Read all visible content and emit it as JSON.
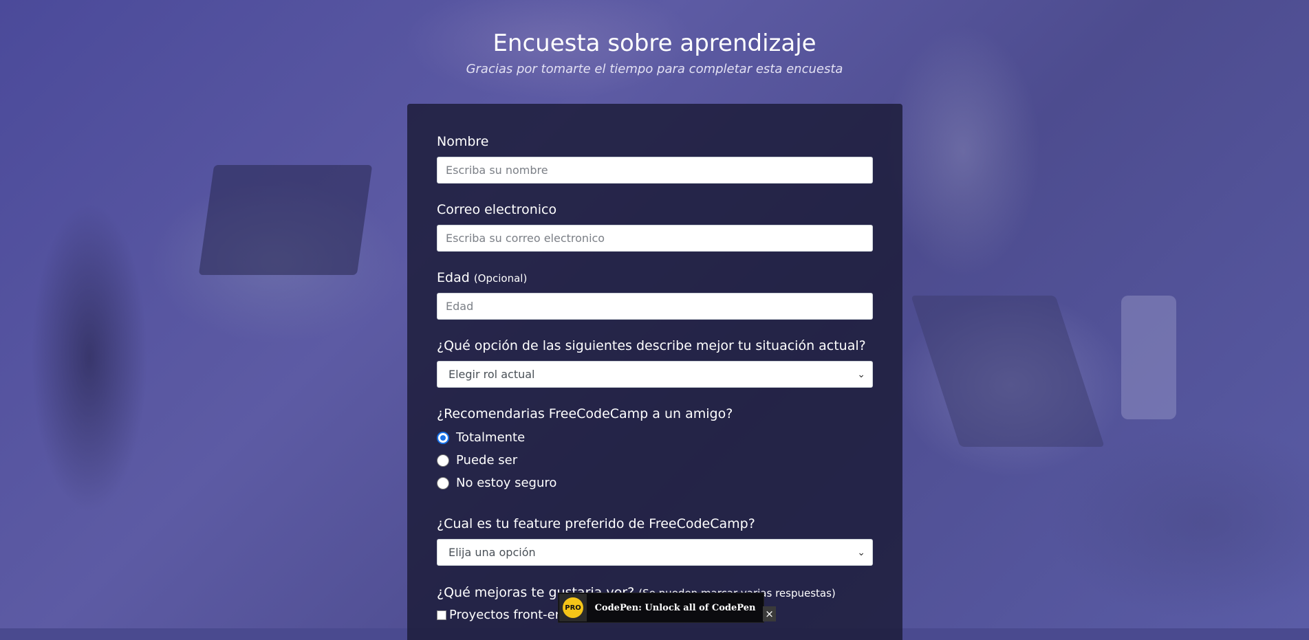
{
  "header": {
    "title": "Encuesta sobre aprendizaje",
    "description": "Gracias por tomarte el tiempo para completar esta encuesta"
  },
  "form": {
    "name": {
      "label": "Nombre",
      "placeholder": "Escriba su nombre",
      "value": ""
    },
    "email": {
      "label": "Correo electronico",
      "placeholder": "Escriba su correo electronico",
      "value": ""
    },
    "age": {
      "label": "Edad",
      "label_note": "(Opcional)",
      "placeholder": "Edad",
      "value": ""
    },
    "role": {
      "label": "¿Qué opción de las siguientes describe mejor tu situación actual?",
      "selected": "Elegir rol actual"
    },
    "recommend": {
      "label": "¿Recomendarias FreeCodeCamp a un amigo?",
      "options": [
        "Totalmente",
        "Puede ser",
        "No estoy seguro"
      ],
      "selected_index": 0
    },
    "feature": {
      "label": "¿Cual es tu feature preferido de FreeCodeCamp?",
      "selected": "Elija una opción"
    },
    "improvements": {
      "label": "¿Qué mejoras te gustaria ver?",
      "label_note": "(Se pueden marcar varias respuestas)",
      "first_option": "Proyectos front-en"
    }
  },
  "codepen_banner": {
    "badge": "PRO",
    "text": "CodePen: Unlock all of CodePen",
    "close": "×"
  },
  "colors": {
    "panel": "#1b1b37",
    "radio_checked": "#1a73e8",
    "pro_badge": "#f5c518"
  }
}
